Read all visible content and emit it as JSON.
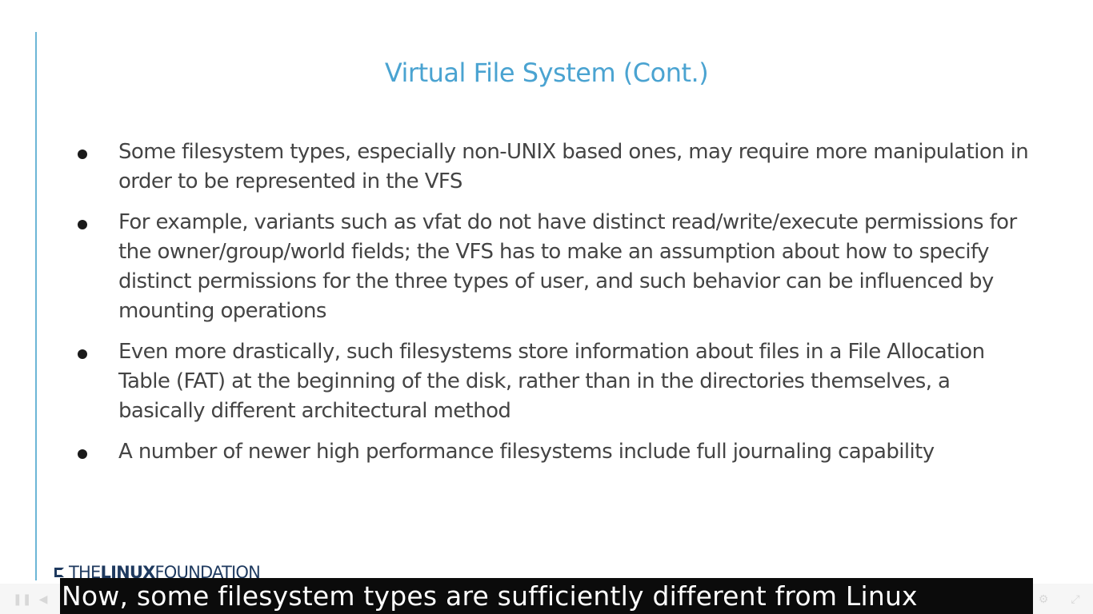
{
  "slide": {
    "title": "Virtual File System (Cont.)",
    "bullets": [
      "Some filesystem types, especially non-UNIX based ones, may require more manipulation in order to be represented in the VFS",
      "For example, variants such as vfat do not have distinct read/write/execute permissions for the owner/group/world fields; the VFS has to make an assumption about how to specify distinct permissions for the three types of user, and such behavior can be influenced by mounting operations",
      "Even more drastically, such filesystems store information about files in a File Allocation Table (FAT) at the beginning of the disk, rather than in the directories themselves, a basically different architectural method",
      "A number of newer high performance filesystems include full journaling capability"
    ],
    "footer_logo": {
      "the": "THE",
      "linux": "LINUX",
      "foundation": "FOUNDATION"
    }
  },
  "player": {
    "caption": "Now, some filesystem types are sufficiently different from Linux",
    "controls": {
      "pause_icon": "pause-icon",
      "volume_icon": "volume-icon",
      "settings_icon": "gear-icon",
      "fullscreen_icon": "fullscreen-icon"
    }
  },
  "colors": {
    "title": "#4aa3d1",
    "rule": "#6cb6d6",
    "body_text": "#444444",
    "logo": "#1f3a5f",
    "caption_bg": "#0b0b0b",
    "caption_text": "#ffffff"
  }
}
